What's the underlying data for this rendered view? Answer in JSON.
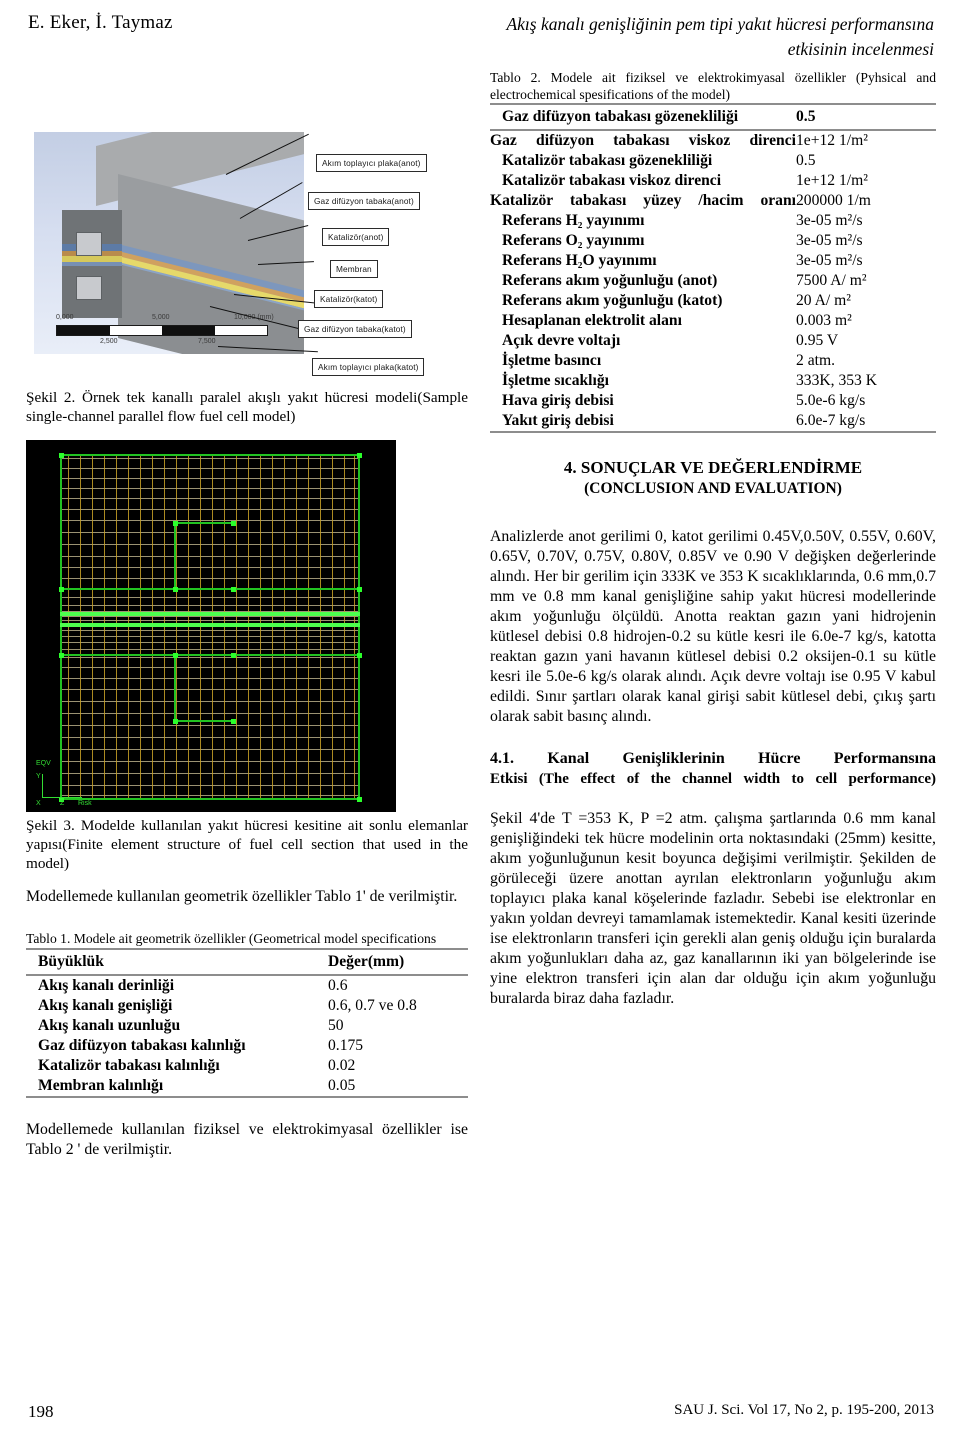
{
  "runhead": {
    "authors": "E. Eker, İ. Taymaz",
    "title_line1": "Akış kanalı genişliğinin pem tipi yakıt hücresi performansına",
    "title_line2": "etkisinin incelenmesi"
  },
  "figure2": {
    "callouts": [
      "Akım toplayıcı plaka(anot)",
      "Gaz difüzyon tabaka(anot)",
      "Katalizör(anot)",
      "Membran",
      "Katalizör(katot)",
      "Gaz difüzyon tabaka(katot)",
      "Akım toplayıcı plaka(katot)"
    ],
    "scale_top": [
      "0,000",
      "5,000",
      "10,000 (mm)"
    ],
    "scale_bottom": [
      "2,500",
      "7,500"
    ],
    "caption": "Şekil 2. Örnek tek kanallı paralel akışlı yakıt hücresi modeli(Sample single-channel parallel flow fuel cell model)"
  },
  "figure3": {
    "triad_labels": [
      "EQV",
      "Y",
      "X",
      "Z",
      "Risk"
    ],
    "caption": "Şekil 3. Modelde kullanılan yakıt hücresi kesitine ait sonlu elemanlar yapısı(Finite element structure of fuel cell section that used in the model)"
  },
  "left_text": {
    "para1": "Modellemede kullanılan geometrik özellikler Tablo 1' de verilmiştir.",
    "para2": "Modellemede kullanılan fiziksel ve elektrokimyasal özellikler ise Tablo 2 ' de verilmiştir."
  },
  "table1": {
    "caption": "Tablo 1. Modele ait geometrik özellikler (Geometrical model specifications",
    "headers": [
      "Büyüklük",
      "Değer(mm)"
    ],
    "rows": [
      {
        "k": "Akış kanalı derinliği",
        "v": "0.6"
      },
      {
        "k": "Akış kanalı genişliği",
        "v": "0.6, 0.7 ve 0.8"
      },
      {
        "k": "Akış kanalı uzunluğu",
        "v": "50"
      },
      {
        "k": "Gaz difüzyon tabakası kalınlığı",
        "v": "0.175"
      },
      {
        "k": "Katalizör tabakası kalınlığı",
        "v": "0.02"
      },
      {
        "k": "Membran kalınlığı",
        "v": "0.05"
      }
    ]
  },
  "table2": {
    "caption": "Tablo 2. Modele ait fiziksel ve elektrokimyasal özellikler (Pyhsical and electrochemical spesifications of the model)",
    "header_row": {
      "k": "Gaz difüzyon tabakası gözenekliliği",
      "v": "0.5"
    },
    "rows": [
      {
        "k": "Gaz difüzyon tabakası viskoz direnci",
        "v": "1e+12 1/m²",
        "justify": true
      },
      {
        "k": "Katalizör tabakası gözenekliliği",
        "v": "0.5"
      },
      {
        "k": "Katalizör tabakası viskoz direnci",
        "v": "1e+12 1/m²"
      },
      {
        "k": "Katalizör tabakası yüzey /hacim oranı",
        "v": "200000 1/m",
        "justify": true
      },
      {
        "k": "Referans H₂ yayınımı",
        "v": "3e-05 m²/s"
      },
      {
        "k": "Referans O₂ yayınımı",
        "v": "3e-05 m²/s"
      },
      {
        "k": "Referans H₂O yayınımı",
        "v": "3e-05 m²/s"
      },
      {
        "k": "Referans akım yoğunluğu (anot)",
        "v": "7500 A/ m²"
      },
      {
        "k": "Referans akım yoğunluğu (katot)",
        "v": "20 A/ m²"
      },
      {
        "k": "Hesaplanan elektrolit alanı",
        "v": "0.003 m²"
      },
      {
        "k": "Açık devre voltajı",
        "v": "0.95 V"
      },
      {
        "k": "İşletme basıncı",
        "v": "2 atm."
      },
      {
        "k": "İşletme sıcaklığı",
        "v": "333K, 353 K"
      },
      {
        "k": "Hava giriş debisi",
        "v": "5.0e-6 kg/s"
      },
      {
        "k": "Yakıt giriş debisi",
        "v": "6.0e-7 kg/s"
      }
    ]
  },
  "section4": {
    "heading_tr": "4. SONUÇLAR VE DEĞERLENDİRME",
    "heading_en": "(CONCLUSION AND EVALUATION)",
    "para1": "Analizlerde anot gerilimi 0, katot gerilimi 0.45V,0.50V, 0.55V, 0.60V, 0.65V, 0.70V, 0.75V, 0.80V, 0.85V ve 0.90 V değişken değerlerinde alındı. Her bir gerilim için 333K ve 353 K sıcaklıklarında, 0.6 mm,0.7 mm ve 0.8 mm kanal genişliğine sahip yakıt hücresi modellerinde akım yoğunluğu ölçüldü. Anotta reaktan gazın yani hidrojenin kütlesel debisi 0.8 hidrojen-0.2 su kütle kesri ile 6.0e-7 kg/s, katotta reaktan gazın yani havanın kütlesel debisi 0.2 oksijen-0.1 su kütle kesri ile 5.0e-6 kg/s olarak alındı. Açık devre voltajı ise 0.95 V kabul edildi. Sınır şartları olarak kanal girişi sabit kütlesel debi, çıkış şartı olarak sabit basınç alındı.",
    "sub_heading_tr": "4.1. Kanal Genişliklerinin Hücre Performansına",
    "sub_heading_en": "Etkisi (The effect of the channel width to cell performance)",
    "para2": "Şekil 4'de T =353 K, P =2 atm. çalışma şartlarında 0.6 mm kanal genişliğindeki tek hücre modelinin orta noktasındaki (25mm) kesitte, akım yoğunluğunun kesit boyunca değişimi verilmiştir. Şekilden de görüleceği üzere anottan ayrılan elektronların yoğunluğu akım toplayıcı plaka kanal köşelerinde fazladır. Sebebi ise elektronlar en yakın yoldan devreyi tamamlamak istemektedir. Kanal kesiti üzerinde ise elektronların transferi için gerekli alan geniş olduğu için buralarda akım yoğunlukları daha az, gaz kanallarının iki yan bölgelerinde ise yine elektron transferi için alan dar olduğu için akım yoğunluğu buralarda biraz daha fazladır."
  },
  "footer": {
    "page_number": "198",
    "journal": "SAU J. Sci. Vol 17, No 2, p. 195-200, 2013"
  }
}
